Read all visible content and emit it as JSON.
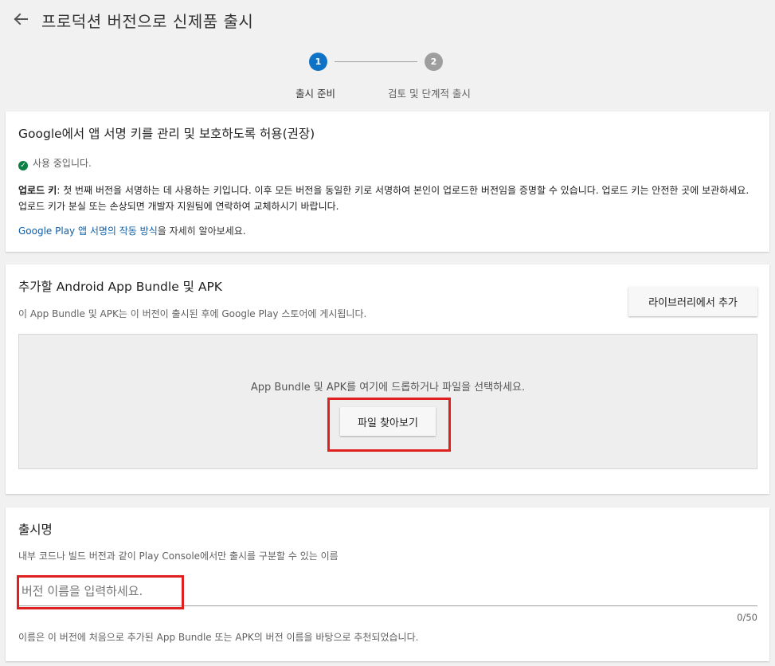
{
  "header": {
    "back_icon": "arrow-left-icon",
    "title": "프로덕션 버전으로 신제품 출시"
  },
  "stepper": {
    "steps": [
      {
        "number": "1",
        "label": "출시 준비",
        "color": "#0e73c6"
      },
      {
        "number": "2",
        "label": "검토 및 단계적 출시",
        "color": "#9e9e9e"
      }
    ]
  },
  "signing": {
    "title": "Google에서 앱 서명 키를 관리 및 보호하도록 허용(권장)",
    "status_icon": "check-circle-icon",
    "status": "사용 중입니다.",
    "upload_key_label": "업로드 키",
    "upload_key_desc": ": 첫 번째 버전을 서명하는 데 사용하는 키입니다. 이후 모든 버전을 동일한 키로 서명하여 본인이 업로드한 버전임을 증명할 수 있습니다. 업로드 키는 안전한 곳에 보관하세요. 업로드 키가 분실 또는 손상되면 개발자 지원팀에 연락하여 교체하시기 바랍니다.",
    "learn_link": "Google Play 앱 서명의 작동 방식",
    "learn_suffix": "을 자세히 알아보세요."
  },
  "bundles": {
    "title": "추가할 Android App Bundle 및 APK",
    "subtitle": "이 App Bundle 및 APK는 이 버전이 출시된 후에 Google Play 스토어에 게시됩니다.",
    "library_button": "라이브러리에서 추가",
    "drop_text": "App Bundle 및 APK를 여기에 드롭하거나 파일을 선택하세요.",
    "browse_button": "파일 찾아보기"
  },
  "release_name": {
    "title": "출시명",
    "subtitle": "내부 코드나 빌드 버전과 같이 Play Console에서만 출시를 구분할 수 있는 이름",
    "placeholder": "버전 이름을 입력하세요.",
    "value": "",
    "counter": "0/50",
    "note": "이름은 이 버전에 처음으로 추가된 App Bundle 또는 APK의 버전 이름을 바탕으로 추천되었습니다."
  },
  "colors": {
    "accent": "#0e73c6",
    "highlight": "#e0201e",
    "success": "#0b8043"
  }
}
